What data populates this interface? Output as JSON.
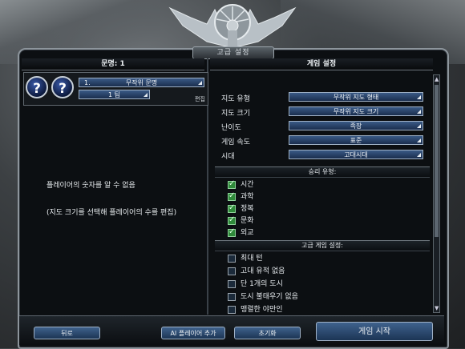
{
  "window": {
    "title": "고급 설정"
  },
  "left_panel": {
    "header": "문명: 1",
    "player": {
      "civ_number": "1.",
      "civ_value": "무작위 문명",
      "team_value": "1 팀",
      "edit_label": "편집"
    },
    "info_line1": "플레이어의 숫자를 알 수 없음",
    "info_line2": "(지도 크기를 선택해 플레이어의 수를 편집)"
  },
  "right_panel": {
    "header": "게임 설정",
    "settings": [
      {
        "label": "지도 유형",
        "value": "무작위 지도 형태"
      },
      {
        "label": "지도 크기",
        "value": "무작위 지도 크기"
      },
      {
        "label": "난이도",
        "value": "족장"
      },
      {
        "label": "게임 속도",
        "value": "표준"
      },
      {
        "label": "시대",
        "value": "고대시대"
      }
    ],
    "victory_header": "승리 유형:",
    "victory_types": [
      {
        "label": "시간",
        "checked": true
      },
      {
        "label": "과학",
        "checked": true
      },
      {
        "label": "정복",
        "checked": true
      },
      {
        "label": "문화",
        "checked": true
      },
      {
        "label": "외교",
        "checked": true
      }
    ],
    "advanced_header": "고급 게임 설정:",
    "advanced_options": [
      {
        "label": "최대 턴",
        "checked": false
      },
      {
        "label": "고대 유적 없음",
        "checked": false
      },
      {
        "label": "단 1개의 도시",
        "checked": false
      },
      {
        "label": "도시 불태우기 없음",
        "checked": false
      },
      {
        "label": "맹렬한 야만인",
        "checked": false
      }
    ]
  },
  "buttons": {
    "back": "뒤로",
    "add_ai": "AI 플레이어 추가",
    "reset": "초기화",
    "start": "게임 시작"
  },
  "colors": {
    "accent": "#2f4f7a",
    "check": "#2f8a3a",
    "frame": "#8d959c"
  },
  "icons": {
    "player_slot": "question-mark-icon"
  }
}
